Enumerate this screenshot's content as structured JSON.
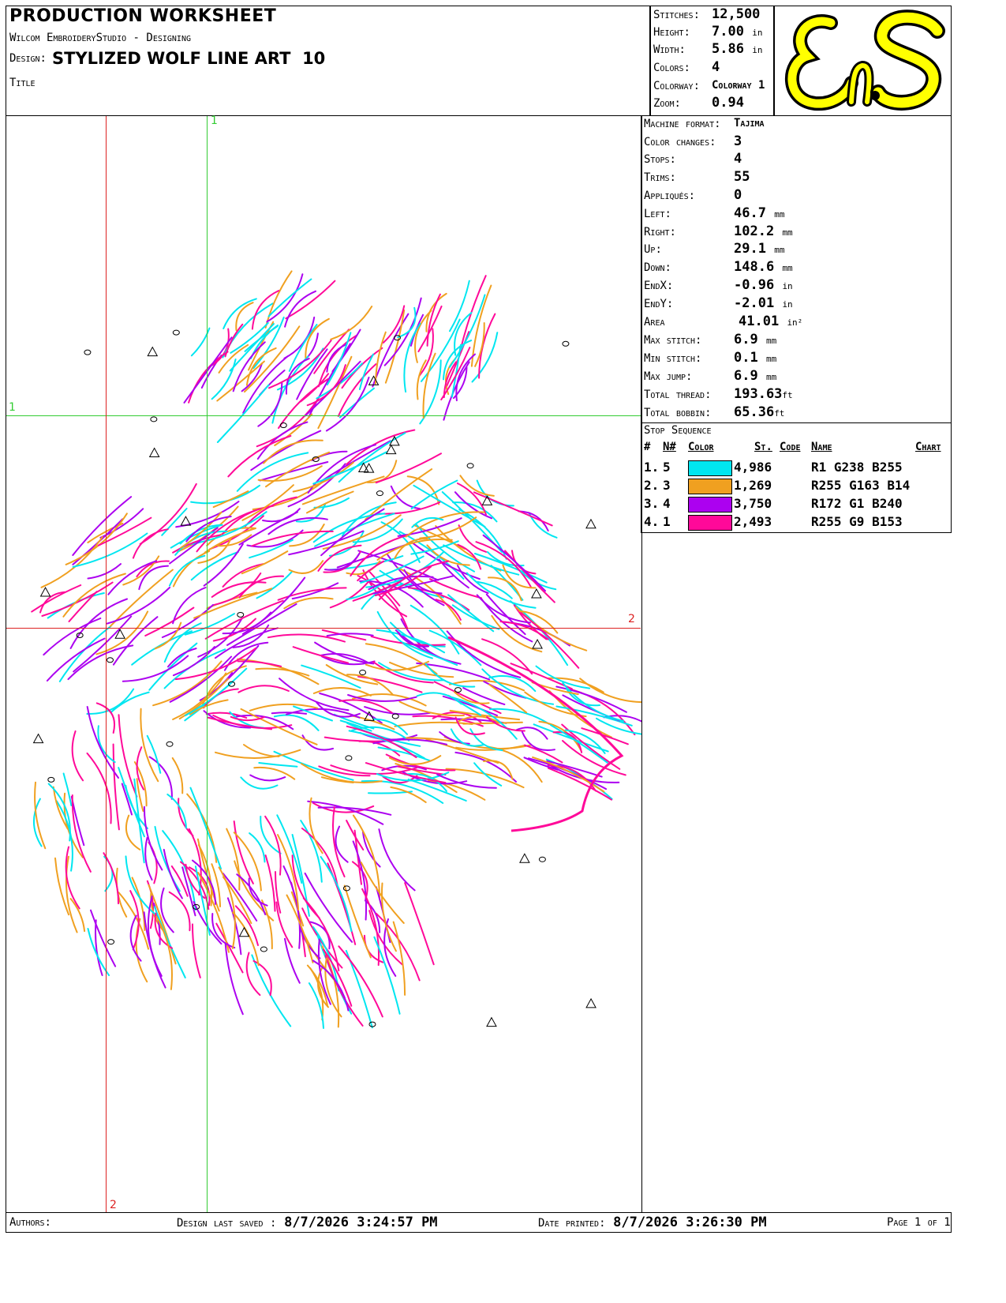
{
  "header": {
    "title": "Production Worksheet",
    "software": "Wilcom EmbroideryStudio - Designing",
    "design_label": "Design:",
    "design_name": "STYLIZED WOLF LINE ART  10",
    "title_label": "Title"
  },
  "summary": [
    {
      "label": "Stitches:",
      "value": "12,500",
      "unit": ""
    },
    {
      "label": "Height:",
      "value": "7.00",
      "unit": "in"
    },
    {
      "label": "Width:",
      "value": "5.86",
      "unit": "in"
    },
    {
      "label": "Colors:",
      "value": "4",
      "unit": ""
    },
    {
      "label": "Colorway:",
      "value": "Colorway 1",
      "unit": ""
    },
    {
      "label": "Zoom:",
      "value": "0.94",
      "unit": ""
    }
  ],
  "logo": {
    "text": "EnS",
    "colors": {
      "fill": "#ffff00",
      "stroke": "#000000"
    }
  },
  "machine": [
    {
      "label": "Machine format:",
      "value": "Tajima",
      "unit": ""
    },
    {
      "label": "Color changes:",
      "value": "3",
      "unit": ""
    },
    {
      "label": "Stops:",
      "value": "4",
      "unit": ""
    },
    {
      "label": "Trims:",
      "value": "55",
      "unit": ""
    },
    {
      "label": "Appliqués:",
      "value": "0",
      "unit": ""
    },
    {
      "label": "Left:",
      "value": "46.7",
      "unit": "mm"
    },
    {
      "label": "Right:",
      "value": "102.2",
      "unit": "mm"
    },
    {
      "label": "Up:",
      "value": "29.1",
      "unit": "mm"
    },
    {
      "label": "Down:",
      "value": "148.6",
      "unit": "mm"
    },
    {
      "label": "EndX:",
      "value": "-0.96",
      "unit": "in"
    },
    {
      "label": "EndY:",
      "value": "-2.01",
      "unit": "in"
    },
    {
      "label": "Area",
      "value": "41.01",
      "unit": "in²"
    },
    {
      "label": "Max stitch:",
      "value": "6.9",
      "unit": "mm"
    },
    {
      "label": "Min stitch:",
      "value": "0.1",
      "unit": "mm"
    },
    {
      "label": "Max jump:",
      "value": "6.9",
      "unit": "mm"
    },
    {
      "label": "Total thread:",
      "value": "193.63",
      "unit": "ft"
    },
    {
      "label": "Total bobbin:",
      "value": "65.36",
      "unit": "ft"
    }
  ],
  "stop_sequence": {
    "title": "Stop Sequence",
    "columns": [
      "#",
      "N#",
      "Color",
      "St.",
      "Code",
      "Name",
      "Chart"
    ],
    "rows": [
      {
        "num": "1.",
        "n": "5",
        "color": "#00e6f0",
        "stitches": "4,986",
        "name": "R1 G238 B255"
      },
      {
        "num": "2.",
        "n": "3",
        "color": "#f0a020",
        "stitches": "1,269",
        "name": "R255 G163 B14"
      },
      {
        "num": "3.",
        "n": "4",
        "color": "#ac01f0",
        "stitches": "3,750",
        "name": "R172 G1 B240"
      },
      {
        "num": "4.",
        "n": "1",
        "color": "#ff0999",
        "stitches": "2,493",
        "name": "R255 G9 B153"
      }
    ]
  },
  "guides": {
    "green": "1",
    "red": "2",
    "colors": {
      "green": "#33cc33",
      "red": "#dd2222"
    }
  },
  "footer": {
    "authors_label": "Authors:",
    "saved_label": "Design last saved :",
    "saved_value": "8/7/2026 3:24:57 PM",
    "printed_label": "Date printed:",
    "printed_value": "8/7/2026 3:26:30 PM",
    "page": "Page 1 of 1"
  }
}
